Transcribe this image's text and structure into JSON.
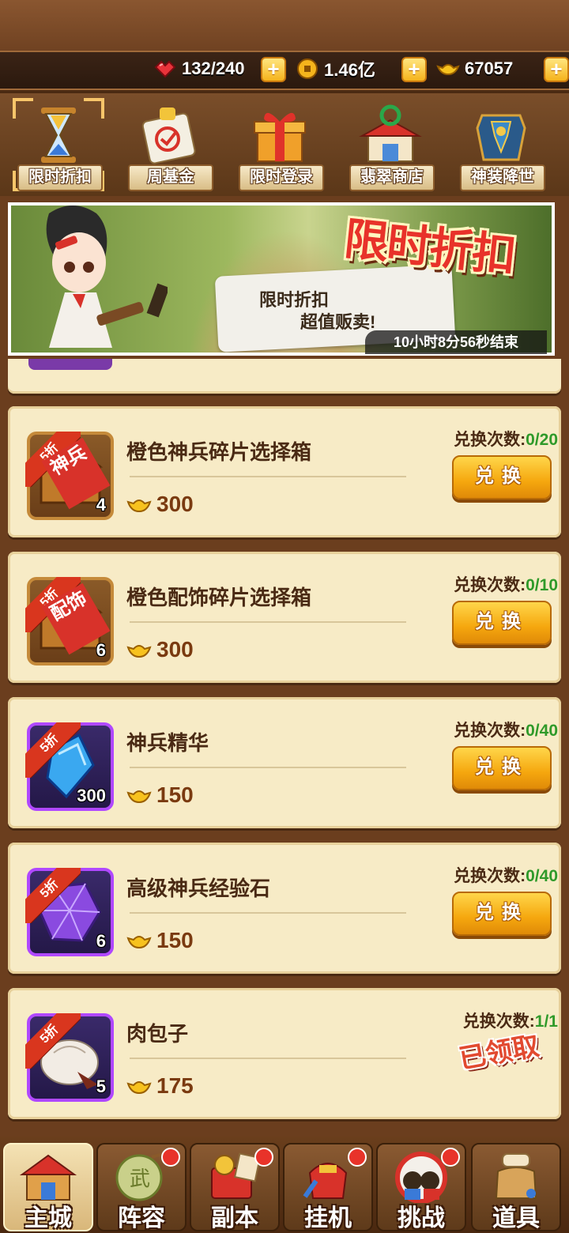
{
  "resources": {
    "stamina": "132/240",
    "coins": "1.46亿",
    "gold_ingots": "67057",
    "plus": "+"
  },
  "event_tabs": [
    {
      "label": "限时折扣",
      "icon": "hourglass-icon",
      "selected": true
    },
    {
      "label": "周基金",
      "icon": "fund-scroll-icon",
      "selected": false
    },
    {
      "label": "限时登录",
      "icon": "gift-box-icon",
      "selected": false
    },
    {
      "label": "翡翠商店",
      "icon": "jade-shop-icon",
      "selected": false
    },
    {
      "label": "神装降世",
      "icon": "armor-icon",
      "selected": false
    }
  ],
  "banner": {
    "title": "限时折扣",
    "bubble_line1": "限时折扣",
    "bubble_line2": "超值贩卖!",
    "timer": "10小时8分56秒结束"
  },
  "items": [
    {
      "name": "橙色神兵碎片选择箱",
      "discount": "5折",
      "tag": "神兵",
      "count": "4",
      "price": "300",
      "exchange_label": "兑换次数:",
      "exchange_count": "0/20",
      "button": "兑换",
      "frame": "gold"
    },
    {
      "name": "橙色配饰碎片选择箱",
      "discount": "5折",
      "tag": "配饰",
      "count": "6",
      "price": "300",
      "exchange_label": "兑换次数:",
      "exchange_count": "0/10",
      "button": "兑换",
      "frame": "gold"
    },
    {
      "name": "神兵精华",
      "discount": "5折",
      "count": "300",
      "price": "150",
      "exchange_label": "兑换次数:",
      "exchange_count": "0/40",
      "button": "兑换",
      "frame": "purple"
    },
    {
      "name": "高级神兵经验石",
      "discount": "5折",
      "count": "6",
      "price": "150",
      "exchange_label": "兑换次数:",
      "exchange_count": "0/40",
      "button": "兑换",
      "frame": "purple"
    },
    {
      "name": "肉包子",
      "discount": "5折",
      "count": "5",
      "price": "175",
      "exchange_label": "兑换次数:",
      "exchange_count": "1/1",
      "claimed": "已领取",
      "frame": "purple"
    }
  ],
  "bottom_nav": [
    {
      "label": "主城",
      "icon": "castle-icon",
      "active": true,
      "dot": false
    },
    {
      "label": "阵容",
      "icon": "formation-icon",
      "active": false,
      "dot": true
    },
    {
      "label": "副本",
      "icon": "dungeon-icon",
      "active": false,
      "dot": true
    },
    {
      "label": "挂机",
      "icon": "idle-icon",
      "active": false,
      "dot": true
    },
    {
      "label": "挑战",
      "icon": "challenge-icon",
      "active": false,
      "dot": true
    },
    {
      "label": "道具",
      "icon": "items-bag-icon",
      "active": false,
      "dot": false
    }
  ],
  "colors": {
    "wood": "#6b3e1e",
    "card": "#f7ebc6",
    "button": "#f5a70e",
    "green_count": "#2f9a2a",
    "discount_red": "#d9361e"
  }
}
